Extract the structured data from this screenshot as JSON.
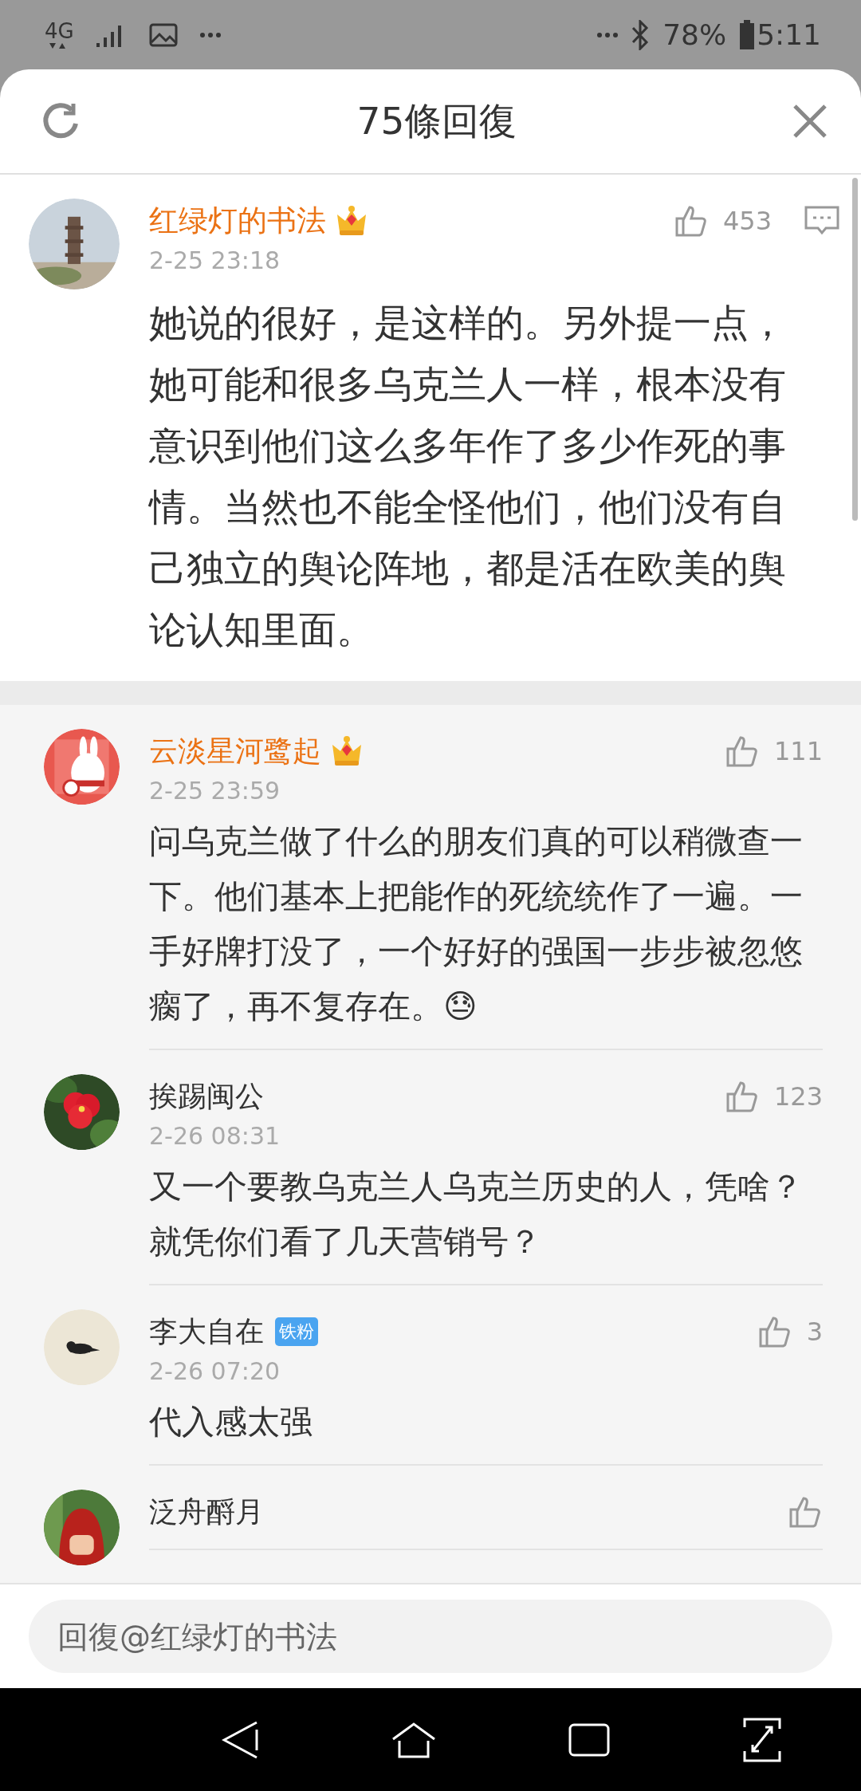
{
  "status_bar": {
    "network": "4G",
    "battery": "78%",
    "time": "5:11"
  },
  "header": {
    "title": "75條回復"
  },
  "main_comment": {
    "author": "红绿灯的书法",
    "vip": true,
    "time": "2-25 23:18",
    "likes": "453",
    "text": "她说的很好，是这样的。另外提一点，她可能和很多乌克兰人一样，根本没有意识到他们这么多年作了多少作死的事情。当然也不能全怪他们，他们没有自己独立的舆论阵地，都是活在欧美的舆论认知里面。"
  },
  "replies": [
    {
      "author": "云淡星河鹭起",
      "vip": true,
      "time": "2-25 23:59",
      "likes": "111",
      "text": "问乌克兰做了什么的朋友们真的可以稍微查一下。他们基本上把能作的死统统作了一遍。一手好牌打没了，一个好好的强国一步步被忽悠瘸了，再不复存在。😓"
    },
    {
      "author": "挨踢闽公",
      "vip": false,
      "time": "2-26 08:31",
      "likes": "123",
      "text": "又一个要教乌克兰人乌克兰历史的人，凭啥？就凭你们看了几天营销号？"
    },
    {
      "author": "李大自在",
      "vip": false,
      "badge": "铁粉",
      "time": "2-26 07:20",
      "likes": "3",
      "text": "代入感太强"
    },
    {
      "author": "泛舟酹月",
      "vip": false
    }
  ],
  "reply_box": {
    "placeholder": "回復@红绿灯的书法"
  }
}
